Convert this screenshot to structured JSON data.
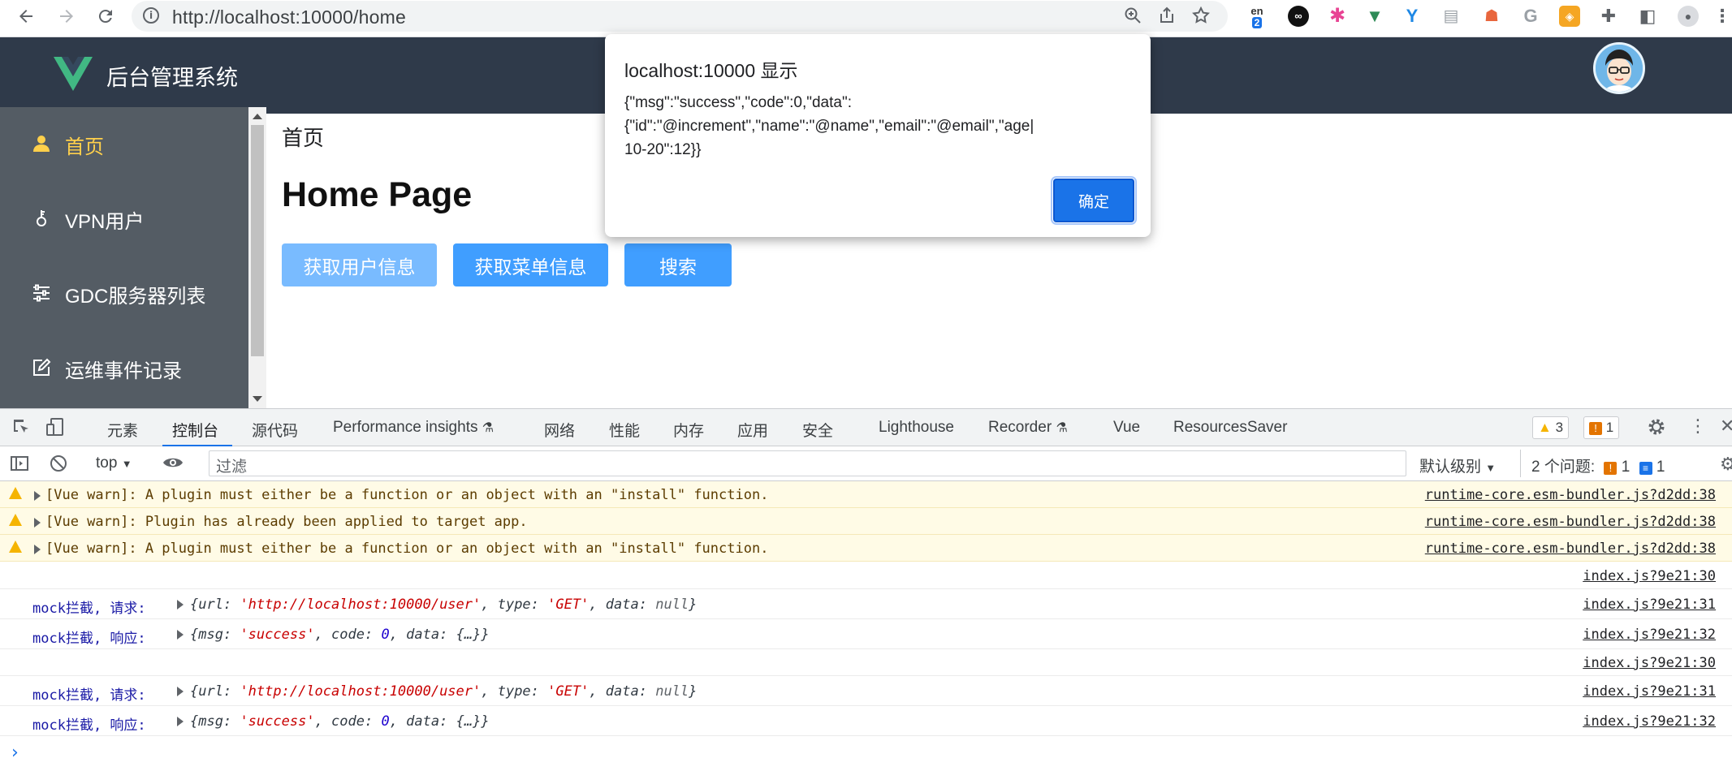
{
  "browser": {
    "url": "http://localhost:10000/home",
    "ext_translate_badge": "2",
    "ext_translate_label": "en"
  },
  "app": {
    "title": "后台管理系统"
  },
  "sidebar": {
    "items": [
      {
        "label": "首页",
        "icon": "user-icon",
        "active": true
      },
      {
        "label": "VPN用户",
        "icon": "key-icon",
        "active": false
      },
      {
        "label": "GDC服务器列表",
        "icon": "sliders-icon",
        "active": false
      },
      {
        "label": "运维事件记录",
        "icon": "edit-icon",
        "active": false
      }
    ]
  },
  "main": {
    "breadcrumb": "首页",
    "heading": "Home Page",
    "buttons": {
      "get_user_info": "获取用户信息",
      "get_menu_info": "获取菜单信息",
      "search": "搜索"
    }
  },
  "dialog": {
    "title": "localhost:10000 显示",
    "message": "{\"msg\":\"success\",\"code\":0,\"data\":\n{\"id\":\"@increment\",\"name\":\"@name\",\"email\":\"@email\",\"age|\n10-20\":12}}",
    "ok_label": "确定"
  },
  "devtools": {
    "tabs": [
      "元素",
      "控制台",
      "源代码",
      "Performance insights",
      "网络",
      "性能",
      "内存",
      "应用",
      "安全",
      "Lighthouse",
      "Recorder",
      "Vue",
      "ResourcesSaver"
    ],
    "active_tab": "控制台",
    "warn_count": "3",
    "issue_count": "1",
    "context": "top",
    "filter_placeholder": "过滤",
    "level": "默认级别",
    "issues_label": "2 个问题:",
    "issues_warn": "1",
    "issues_info": "1"
  },
  "console": {
    "warnings": [
      {
        "text": "[Vue warn]: A plugin must either be a function or an object with an \"install\" function.",
        "source": "runtime-core.esm-bundler.js?d2dd:38"
      },
      {
        "text": "[Vue warn]: Plugin has already been applied to target app.",
        "source": "runtime-core.esm-bundler.js?d2dd:38"
      },
      {
        "text": "[Vue warn]: A plugin must either be a function or an object with an \"install\" function.",
        "source": "runtime-core.esm-bundler.js?d2dd:38"
      }
    ],
    "logs": [
      {
        "label": "",
        "source": "index.js?9e21:30"
      },
      {
        "label": "mock拦截, 请求:",
        "source": "index.js?9e21:31"
      },
      {
        "label": "mock拦截, 响应:",
        "source": "index.js?9e21:32"
      },
      {
        "label": "",
        "source": "index.js?9e21:30"
      },
      {
        "label": "mock拦截, 请求:",
        "source": "index.js?9e21:31"
      },
      {
        "label": "mock拦截, 响应:",
        "source": "index.js?9e21:32"
      }
    ],
    "request_obj": {
      "url_key": "url: ",
      "url": "'http://localhost:10000/user'",
      "type_key": ", type: ",
      "type": "'GET'",
      "data_key": ", data: ",
      "data": "null"
    },
    "response_obj": {
      "msg_key": "msg: ",
      "msg": "'success'",
      "code_key": ", code: ",
      "code": "0",
      "data_key": ", data: ",
      "data": "{…}"
    }
  },
  "colors": {
    "header_bg": "#2f3a4a",
    "sidebar_bg": "#545c64",
    "active_menu": "#ffd04b",
    "primary": "#409eff",
    "primary_light": "#79bbff"
  }
}
